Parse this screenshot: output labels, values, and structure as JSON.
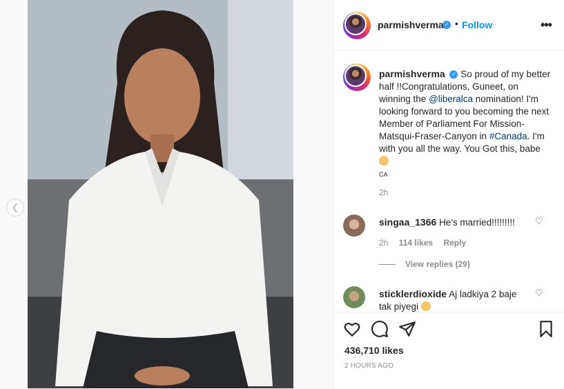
{
  "post": {
    "username": "parmishverma",
    "follow_label": "Follow",
    "dot": "•",
    "more_label": "•••",
    "caption": {
      "username": "parmishverma",
      "part1": "So proud of my better half !!Congratulations, Guneet, on winning the ",
      "mention": "@liberalca",
      "part2": " nomination! I'm looking forward to you becoming the next Member of Parliament For Mission-Matsqui-Fraser-Canyon in ",
      "hashtag": "#Canada",
      "part3": ". I'm with you all the way. You Got this, babe ",
      "country": "CA",
      "time": "2h"
    },
    "comments": [
      {
        "username": "singaa_1366",
        "text": "He's married!!!!!!!!!",
        "time": "2h",
        "likes": "114 likes",
        "reply": "Reply",
        "view_replies": "View replies (29)"
      },
      {
        "username": "sticklerdioxide",
        "text": "Aj ladkiya 2 baje tak piyegi"
      }
    ],
    "likes_count": "436,710 likes",
    "posted_ago": "2 HOURS AGO"
  },
  "icons": {
    "carousel_prev": "chevron-left-icon",
    "heart": "heart-icon",
    "comment": "comment-icon",
    "share": "share-icon",
    "save": "bookmark-icon"
  },
  "colors": {
    "link": "#0095f6",
    "verified": "#3897f0",
    "mention": "#00376b",
    "muted": "#8e8e8e"
  }
}
